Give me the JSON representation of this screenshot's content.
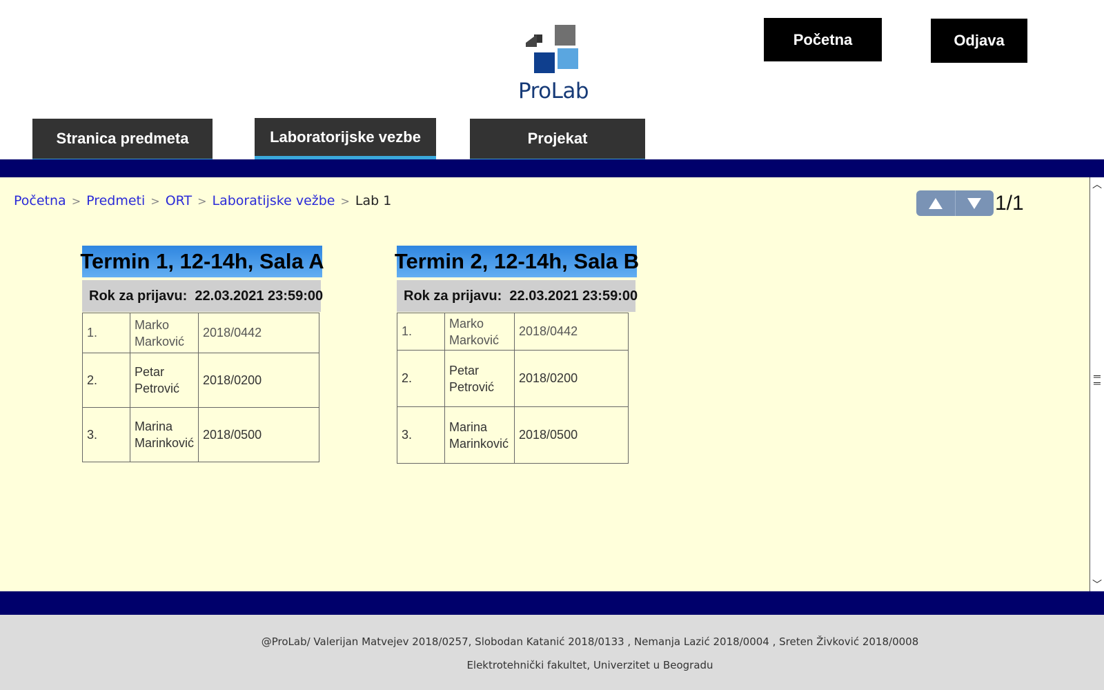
{
  "header": {
    "logo_text": "ProLab",
    "home_button": "Početna",
    "logout_button": "Odjava"
  },
  "tabs": [
    {
      "label": "Stranica predmeta"
    },
    {
      "label": "Laboratorijske vezbe",
      "active": true
    },
    {
      "label": "Projekat"
    }
  ],
  "breadcrumb": {
    "items": [
      "Početna",
      "Predmeti",
      "ORT",
      "Laboratijske vežbe"
    ],
    "separator": ">",
    "current": "Lab 1"
  },
  "pager": {
    "label": "1/1"
  },
  "termini": [
    {
      "title": "Termin 1, 12-14h, Sala A",
      "deadline_label": "Rok za prijavu:",
      "deadline_value": "22.03.2021 23:59:00",
      "rows": [
        {
          "num": "1.",
          "first": "Marko",
          "last": "Marković",
          "index": "2018/0442"
        },
        {
          "num": "2.",
          "first": "Petar",
          "last": "Petrović",
          "index": "2018/0200"
        },
        {
          "num": "3.",
          "first": "Marina",
          "last": "Marinković",
          "index": "2018/0500"
        }
      ]
    },
    {
      "title": "Termin 2, 12-14h, Sala B",
      "deadline_label": "Rok za prijavu:",
      "deadline_value": "22.03.2021 23:59:00",
      "rows": [
        {
          "num": "1.",
          "first": "Marko",
          "last": "Marković",
          "index": "2018/0442"
        },
        {
          "num": "2.",
          "first": "Petar",
          "last": "Petrović",
          "index": "2018/0200"
        },
        {
          "num": "3.",
          "first": "Marina",
          "last": "Marinković",
          "index": "2018/0500"
        }
      ]
    }
  ],
  "footer": {
    "line1": "@ProLab/ Valerijan Matvejev 2018/0257, Slobodan Katanić 2018/0133 , Nemanja Lazić 2018/0004 , Sreten Živković 2018/0008",
    "line2": "Elektrotehnički fakultet, Univerzitet u Beogradu"
  },
  "colors": {
    "band": "#00006b",
    "content_bg": "#ffffdb",
    "tab_bg": "#333333",
    "tab_active_underline": "#3aa8dc",
    "link": "#2a2ad8",
    "termin_title_gradient": "#2f86e0"
  },
  "icons": {
    "logo": "prolab-logo-icon",
    "pager_up": "triangle-up-icon",
    "pager_down": "triangle-down-icon"
  }
}
